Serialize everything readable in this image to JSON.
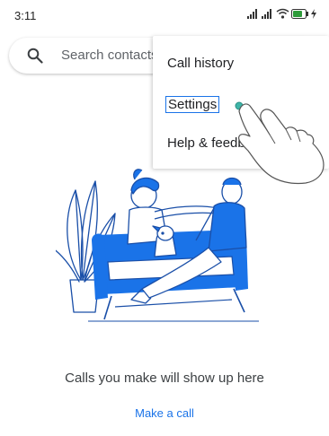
{
  "status_bar": {
    "time": "3:11"
  },
  "search": {
    "placeholder": "Search contacts"
  },
  "menu": {
    "items": [
      {
        "label": "Call history"
      },
      {
        "label": "Settings"
      },
      {
        "label": "Help & feedback"
      }
    ]
  },
  "empty_state": {
    "message": "Calls you make will show up here",
    "action_label": "Make a call"
  },
  "colors": {
    "accent": "#1a73e8",
    "illustration_blue": "#1a73e8",
    "illustration_line": "#1a4fa8"
  }
}
